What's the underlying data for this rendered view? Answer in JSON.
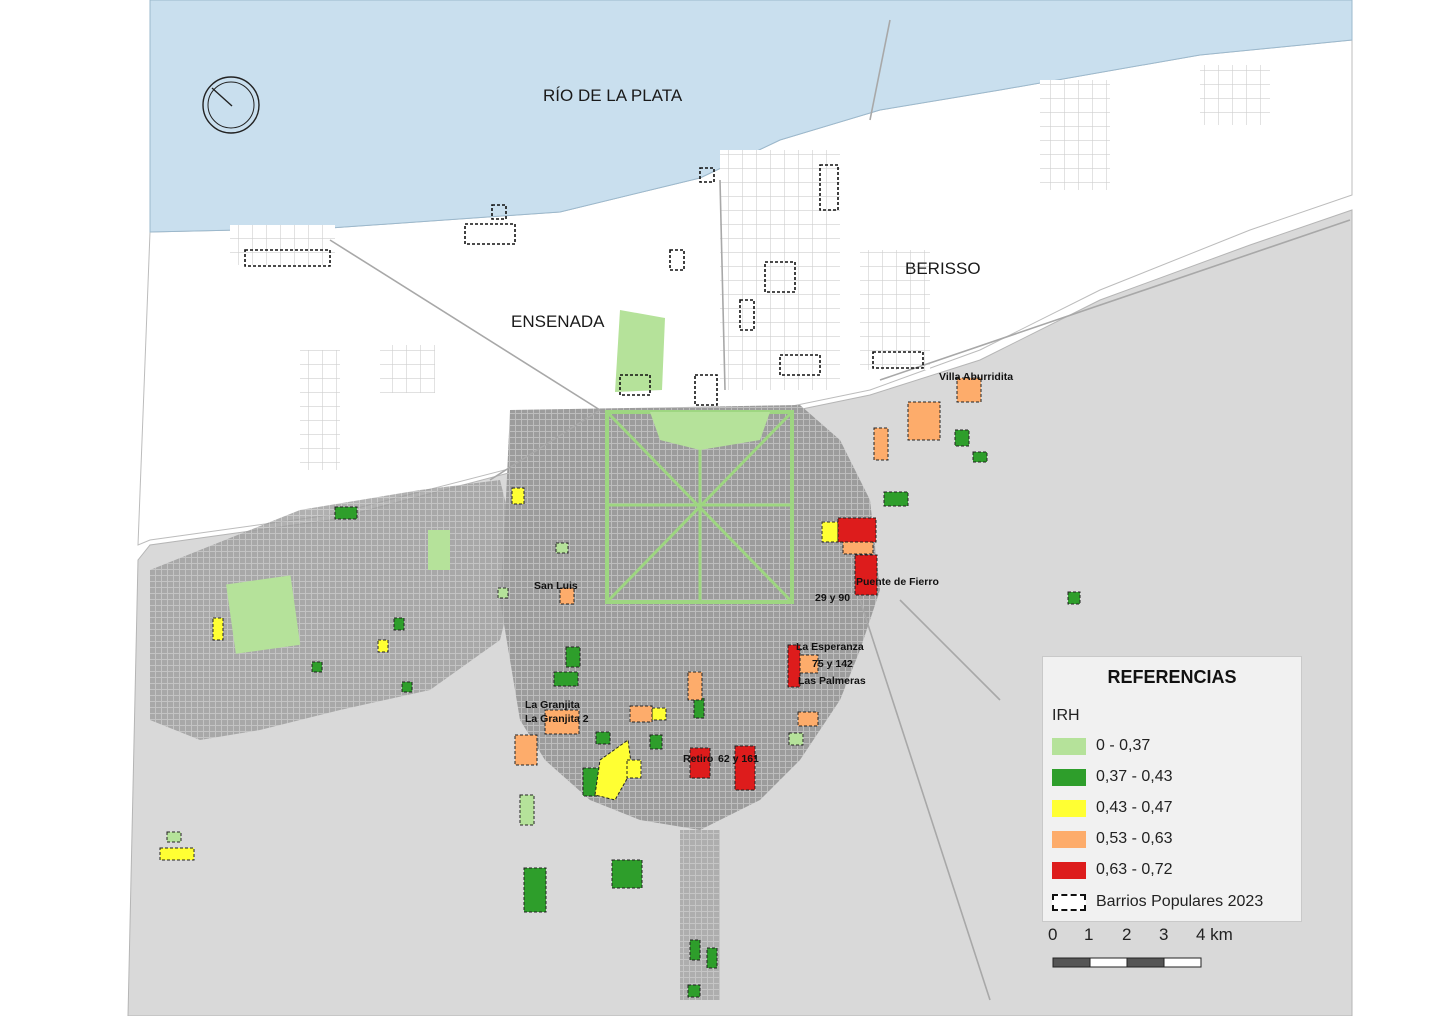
{
  "labels": {
    "rio": "RÍO DE LA PLATA",
    "berisso": "BERISSO",
    "ensenada": "ENSENADA"
  },
  "barrios": {
    "villa_aburridita": "Villa Aburridita",
    "san_luis": "San Luis",
    "puente_de_fierro": "Puente de Fierro",
    "b29y90": "29 y 90",
    "la_esperanza": "La Esperanza",
    "b75y142": "75 y 142",
    "las_palmeras": "Las Palmeras",
    "la_granjita": "La Granjita",
    "la_granjita2": "La Granjita 2",
    "retiro": "Retiro",
    "b62y161": "62 y 161"
  },
  "legend": {
    "title": "REFERENCIAS",
    "subtitle": "IRH",
    "items": [
      {
        "label": "0 - 0,37",
        "color": "#b5e29a"
      },
      {
        "label": "0,37 - 0,43",
        "color": "#2e9e2b"
      },
      {
        "label": "0,43 - 0,47",
        "color": "#ffff33"
      },
      {
        "label": "0,53 - 0,63",
        "color": "#fdac6b"
      },
      {
        "label": "0,63 - 0,72",
        "color": "#dd1c1c"
      }
    ],
    "boundary_label": "Barrios Populares 2023"
  },
  "scale": {
    "ticks": [
      "0",
      "1",
      "2",
      "3",
      "4 km"
    ]
  },
  "colors": {
    "water": "#c9dfee",
    "land": "#d9d9d9",
    "urban": "#a9a9a9",
    "white_area": "#ffffff"
  }
}
